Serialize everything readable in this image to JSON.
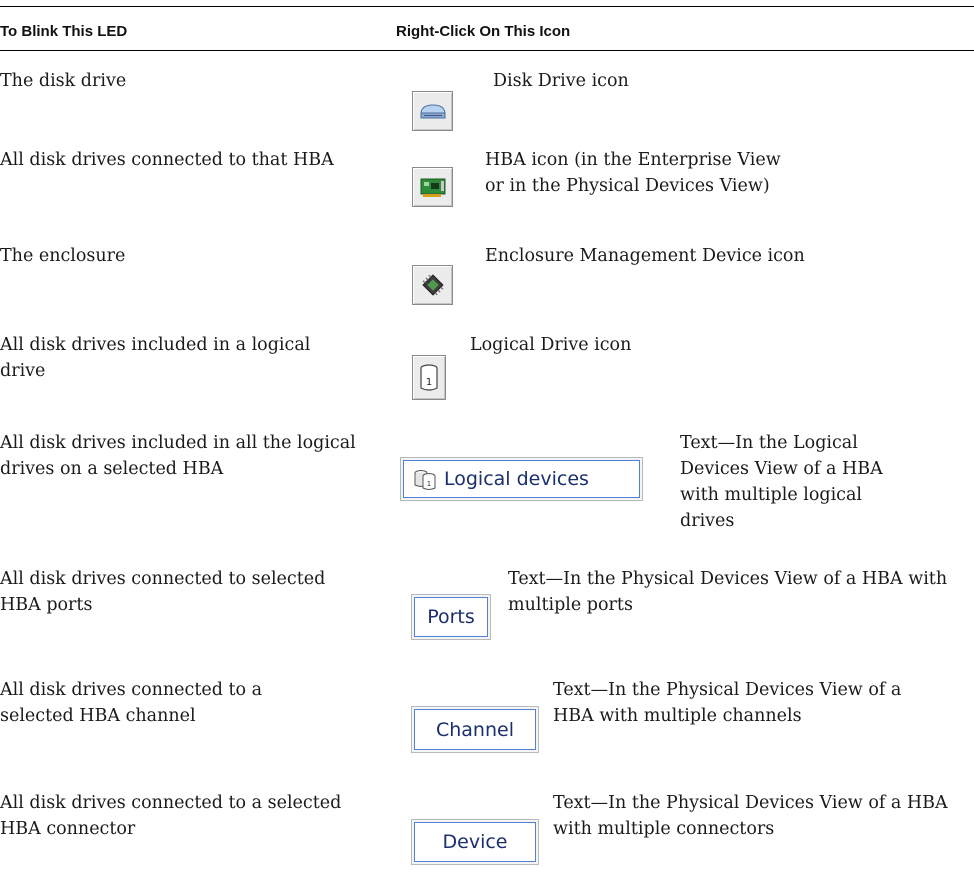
{
  "table": {
    "headers": {
      "col1": "To Blink This LED",
      "col2": "Right-Click On This Icon"
    },
    "rows": [
      {
        "led": "The disk drive",
        "icon": "disk-drive-icon",
        "desc": "Disk Drive icon"
      },
      {
        "led": "All disk drives connected to that HBA",
        "icon": "hba-card-icon",
        "desc": "HBA icon (in the Enterprise View or in the Physical Devices View)"
      },
      {
        "led": "The enclosure",
        "icon": "enclosure-chip-icon",
        "desc": "Enclosure Management Device icon"
      },
      {
        "led": "All disk drives included in a logical drive",
        "icon": "logical-drive-icon",
        "desc": "Logical Drive icon"
      },
      {
        "led": "All disk drives included in all the logical drives on a selected HBA",
        "icon": "logical-devices-icon",
        "button_label": "Logical devices",
        "desc": "Text—In the Logical Devices View of a HBA with multiple logical drives"
      },
      {
        "led": "All disk drives connected to selected HBA ports",
        "button_label": "Ports",
        "desc": "Text—In the Physical Devices View of a HBA with multiple ports"
      },
      {
        "led": "All disk drives connected to a selected HBA channel",
        "button_label": "Channel",
        "desc": "Text—In the Physical Devices View of a HBA with multiple channels"
      },
      {
        "led": "All disk drives connected to a selected HBA connector",
        "button_label": "Device",
        "desc": "Text—In the Physical Devices View of a HBA with multiple connectors"
      }
    ]
  }
}
